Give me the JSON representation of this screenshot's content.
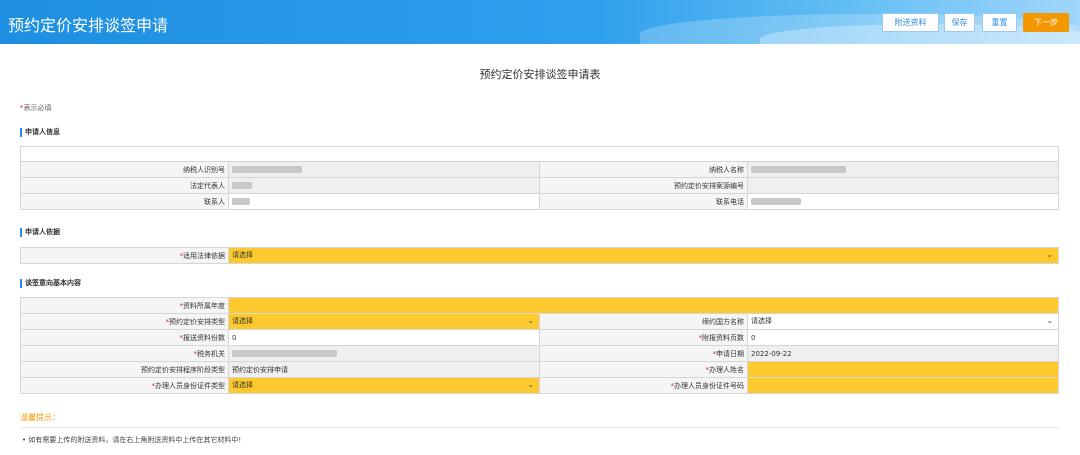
{
  "header": {
    "title": "预约定价安排谈签申请",
    "buttons": {
      "attachments": "附送资料",
      "save": "保存",
      "reset": "重置",
      "next": "下一步"
    }
  },
  "form_title": "预约定价安排谈签申请表",
  "required_note": "表示必填",
  "applicant_info": {
    "section_title": "申请人信息",
    "taxpayer_id_label": "纳税人识别号",
    "taxpayer_name_label": "纳税人名称",
    "legal_rep_label": "法定代表人",
    "case_no_label": "预约定价安排案源编号",
    "contact_label": "联系人",
    "contact_phone_label": "联系电话"
  },
  "applicant_basis": {
    "section_title": "申请人依据",
    "legal_basis_label": "适用法律依据",
    "legal_basis_value": "请选择"
  },
  "intent": {
    "section_title": "谈签意向基本内容",
    "data_year_label": "资料所属年度",
    "apa_type_label": "预约定价安排类型",
    "apa_type_value": "请选择",
    "treaty_country_label": "缔约国方名称",
    "treaty_country_value": "请选择",
    "copies_label": "报送资料份数",
    "copies_value": "0",
    "pages_label": "附报资料页数",
    "pages_value": "0",
    "tax_office_label": "税务机关",
    "apply_date_label": "申请日期",
    "apply_date_value": "2022-09-22",
    "stage_type_label": "预约定价安排程序阶段类型",
    "stage_type_value": "预约定价安排申请",
    "handler_name_label": "办理人姓名",
    "handler_id_type_label": "办理人员身份证件类型",
    "handler_id_type_value": "请选择",
    "handler_id_no_label": "办理人员身份证件号码"
  },
  "tips": {
    "title": "温馨提示：",
    "text": "• 如有需要上传的附送资料，请在右上角附送资料中上传在其它材料中!"
  },
  "colors": {
    "brand_blue": "#2b8be0",
    "required_yellow": "#fcc92e",
    "next_orange": "#f39800",
    "required_red": "#e02020"
  },
  "icons": {
    "select_arrow": "chevron-down-icon"
  }
}
